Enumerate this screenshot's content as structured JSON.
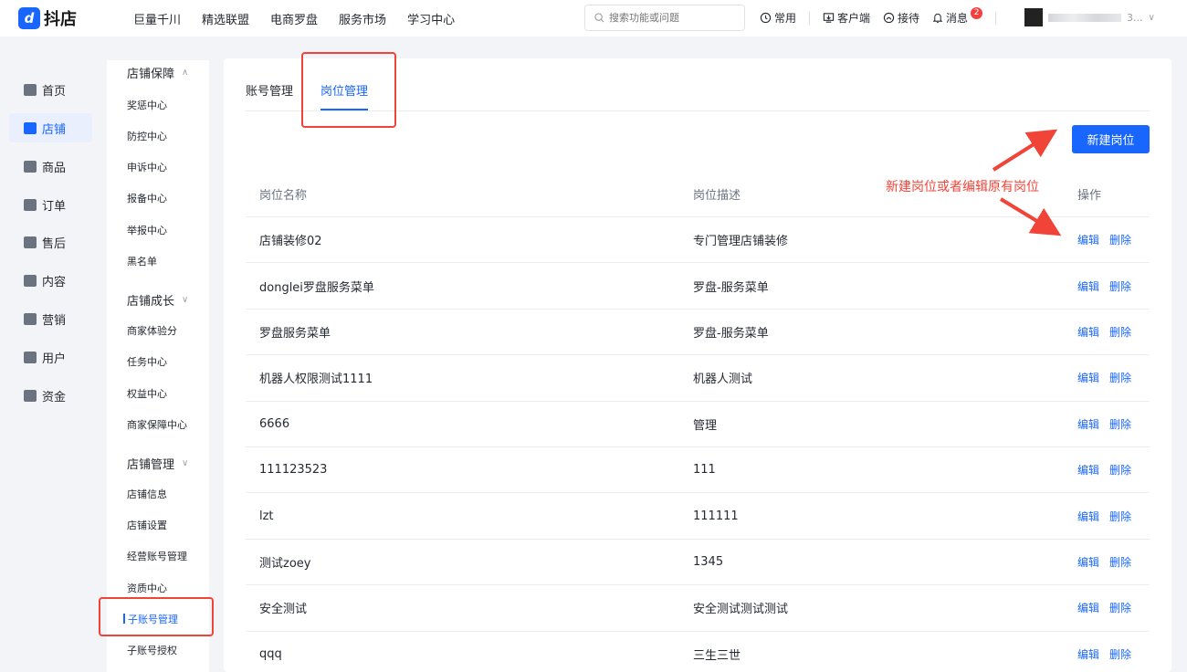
{
  "brand": {
    "name": "抖店"
  },
  "topnav": [
    "巨量千川",
    "精选联盟",
    "电商罗盘",
    "服务市场",
    "学习中心"
  ],
  "search": {
    "placeholder": "搜索功能或问题"
  },
  "tools": {
    "common": "常用",
    "client": "客户端",
    "reception": "接待",
    "messages": "消息",
    "message_count": "2"
  },
  "user": {
    "name_suffix": "3..."
  },
  "leftnav": [
    {
      "label": "首页",
      "icon": "home-icon"
    },
    {
      "label": "店铺",
      "icon": "store-icon",
      "active": true
    },
    {
      "label": "商品",
      "icon": "product-icon"
    },
    {
      "label": "订单",
      "icon": "order-icon"
    },
    {
      "label": "售后",
      "icon": "after-sale-icon"
    },
    {
      "label": "内容",
      "icon": "content-icon"
    },
    {
      "label": "营销",
      "icon": "marketing-icon"
    },
    {
      "label": "用户",
      "icon": "user-icon"
    },
    {
      "label": "资金",
      "icon": "wallet-icon"
    }
  ],
  "subnav": {
    "group0": "店铺保障",
    "items0": [
      "奖惩中心",
      "防控中心",
      "申诉中心",
      "报备中心",
      "举报中心",
      "黑名单"
    ],
    "group1": "店铺成长",
    "items1": [
      "商家体验分",
      "任务中心",
      "权益中心",
      "商家保障中心"
    ],
    "group2": "店铺管理",
    "items2": [
      "店铺信息",
      "店铺设置",
      "经营账号管理",
      "资质中心",
      "子账号管理",
      "子账号授权"
    ]
  },
  "tabs": {
    "accounts": "账号管理",
    "positions": "岗位管理"
  },
  "new_button": "新建岗位",
  "annotation": "新建岗位或者编辑原有岗位",
  "table": {
    "headers": {
      "name": "岗位名称",
      "desc": "岗位描述",
      "ops": "操作"
    },
    "edit": "编辑",
    "delete": "删除",
    "rows": [
      {
        "name": "店铺装修02",
        "desc": "专门管理店铺装修"
      },
      {
        "name": "donglei罗盘服务菜单",
        "desc": "罗盘-服务菜单"
      },
      {
        "name": "罗盘服务菜单",
        "desc": "罗盘-服务菜单"
      },
      {
        "name": "机器人权限测试1111",
        "desc": "机器人测试"
      },
      {
        "name": "6666",
        "desc": "管理"
      },
      {
        "name": "111123523",
        "desc": "111"
      },
      {
        "name": "lzt",
        "desc": "111111"
      },
      {
        "name": "测试zoey",
        "desc": "1345"
      },
      {
        "name": "安全测试",
        "desc": "安全测试测试测试"
      },
      {
        "name": "qqq",
        "desc": "三生三世"
      }
    ]
  }
}
